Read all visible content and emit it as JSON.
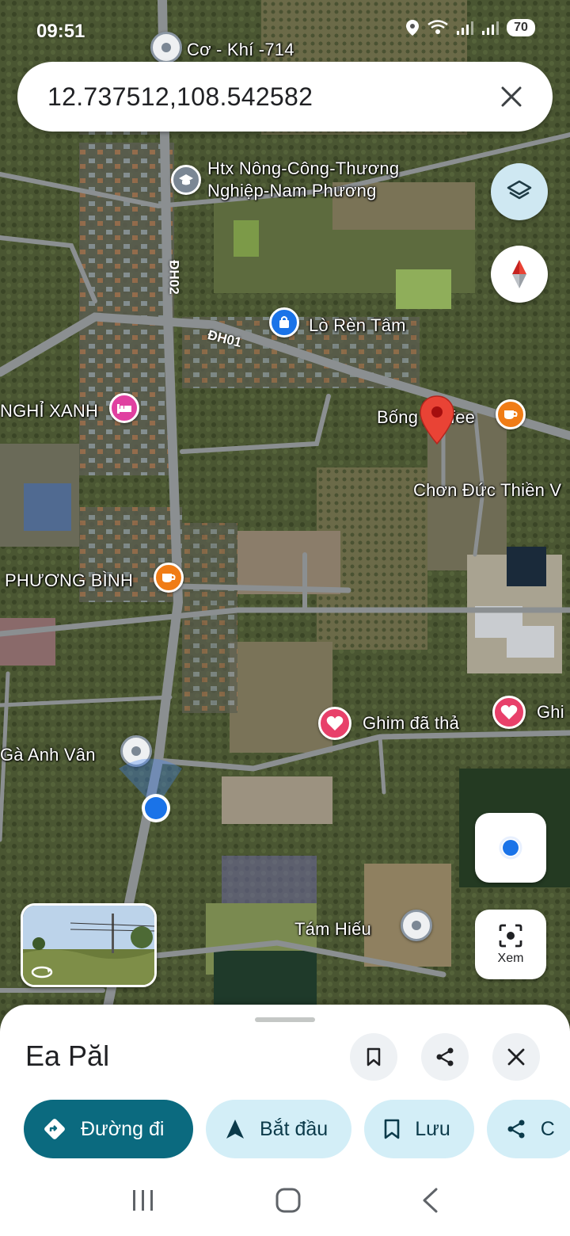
{
  "status_bar": {
    "time": "09:51",
    "battery": "70",
    "icons": [
      "location-icon",
      "wifi-icon",
      "signal-icon",
      "signal-icon-2"
    ]
  },
  "search": {
    "value": "12.737512,108.542582"
  },
  "map": {
    "labels": {
      "co_khi": "Cơ - Khí -714",
      "htx_line1": "Htx Nông-Công-Thương",
      "htx_line2": "Nghiệp-Nam Phương",
      "lo_ren": "Lò Rèn Tâm",
      "nghi_xanh": "NGHỈ XANH",
      "bong_coffee": "Bống Coffee",
      "chon_duc": "Chơn Đức Thiền V",
      "phuong_binh": "PHƯƠNG BÌNH",
      "ghim1": "Ghim đã thả",
      "ghim2": "Ghi",
      "ga_anh_van": "Gà Anh Vân",
      "tam_hieu": "Tám Hiếu"
    },
    "roads": {
      "dh02": "ĐH02",
      "dh01": "ĐH01"
    },
    "colors": {
      "pin": "#d93025",
      "my_location": "#1a73e8",
      "heart": "#e8406a",
      "cafe": "#f07c16",
      "hotel": "#e040a0"
    }
  },
  "controls": {
    "xem": "Xem"
  },
  "sheet": {
    "title": "Ea Păl",
    "actions": [
      {
        "label": "Đường đi",
        "icon": "directions-icon"
      },
      {
        "label": "Bắt đầu",
        "icon": "navigation-arrow-icon"
      },
      {
        "label": "Lưu",
        "icon": "bookmark-icon"
      },
      {
        "label": "C",
        "icon": "share-icon"
      }
    ]
  }
}
